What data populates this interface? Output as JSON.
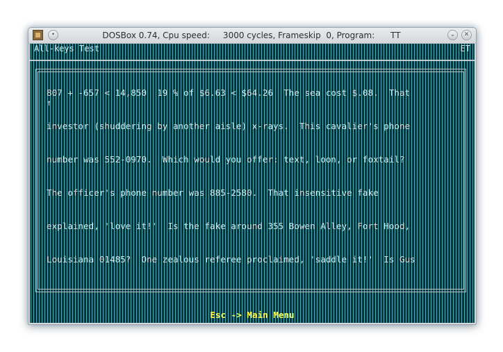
{
  "window": {
    "title": "DOSBox 0.74, Cpu speed:     3000 cycles, Frameskip  0, Program:      TT"
  },
  "icons": {
    "app": "dosbox-app-icon",
    "menu": "window-menu-icon",
    "shade": "shade-chevron-down-icon",
    "close": "close-icon"
  },
  "status": {
    "left": "All-keys Test",
    "right": "ET"
  },
  "content": {
    "cursor": "↑",
    "lines": [
      "807 + -657 < 14,850  19 % of $6.63 < $64.26  The sea cost $.08.  That",
      "investor (shuddering by another aisle) x-rays.  This cavalier's phone",
      "number was 552-0970.  Which would you offer: text, loon, or foxtail?",
      "The officer's phone number was 885-2580.  That insensitive fake",
      "explained, 'love it!'  Is the fake around 355 Bowen Alley, Fort Hood,",
      "Louisiana 01485?  One zealous referee proclaimed, 'saddle it!'  Is Gus"
    ]
  },
  "footer": {
    "label": "Esc -> Main Menu"
  },
  "colors": {
    "text": "#d7e3e5",
    "footer": "#ffff55",
    "scanline": "#4bb3be"
  }
}
